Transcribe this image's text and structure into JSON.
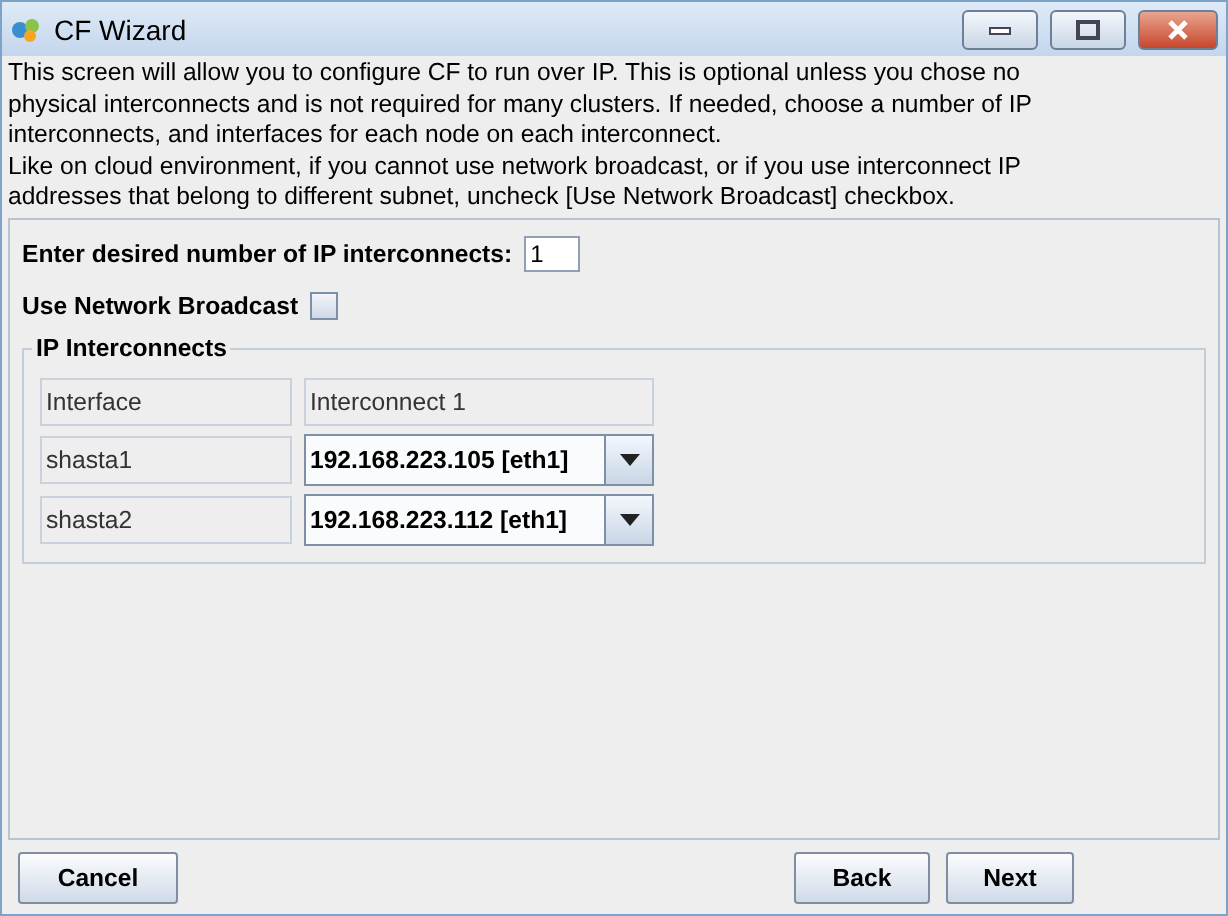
{
  "window": {
    "title": "CF Wizard"
  },
  "description": [
    "This screen will allow you to configure CF to run over IP.  This is optional unless you chose no",
    "physical interconnects and is not required for many clusters.  If needed, choose a number of IP",
    "interconnects, and interfaces for each node on each interconnect.",
    " Like on cloud environment, if you cannot use network broadcast, or if you use interconnect IP",
    "addresses that belong to different subnet, uncheck [Use Network Broadcast] checkbox."
  ],
  "count_field": {
    "label": "Enter desired number of IP interconnects:",
    "value": "1"
  },
  "broadcast": {
    "label": "Use Network Broadcast",
    "checked": false
  },
  "group": {
    "title": "IP Interconnects",
    "columns": [
      "Interface",
      "Interconnect 1"
    ],
    "rows": [
      {
        "node": "shasta1",
        "interface": "192.168.223.105 [eth1]"
      },
      {
        "node": "shasta2",
        "interface": "192.168.223.112 [eth1]"
      }
    ]
  },
  "buttons": {
    "left": [
      "Cancel"
    ],
    "right": [
      "Back",
      "Next"
    ]
  }
}
